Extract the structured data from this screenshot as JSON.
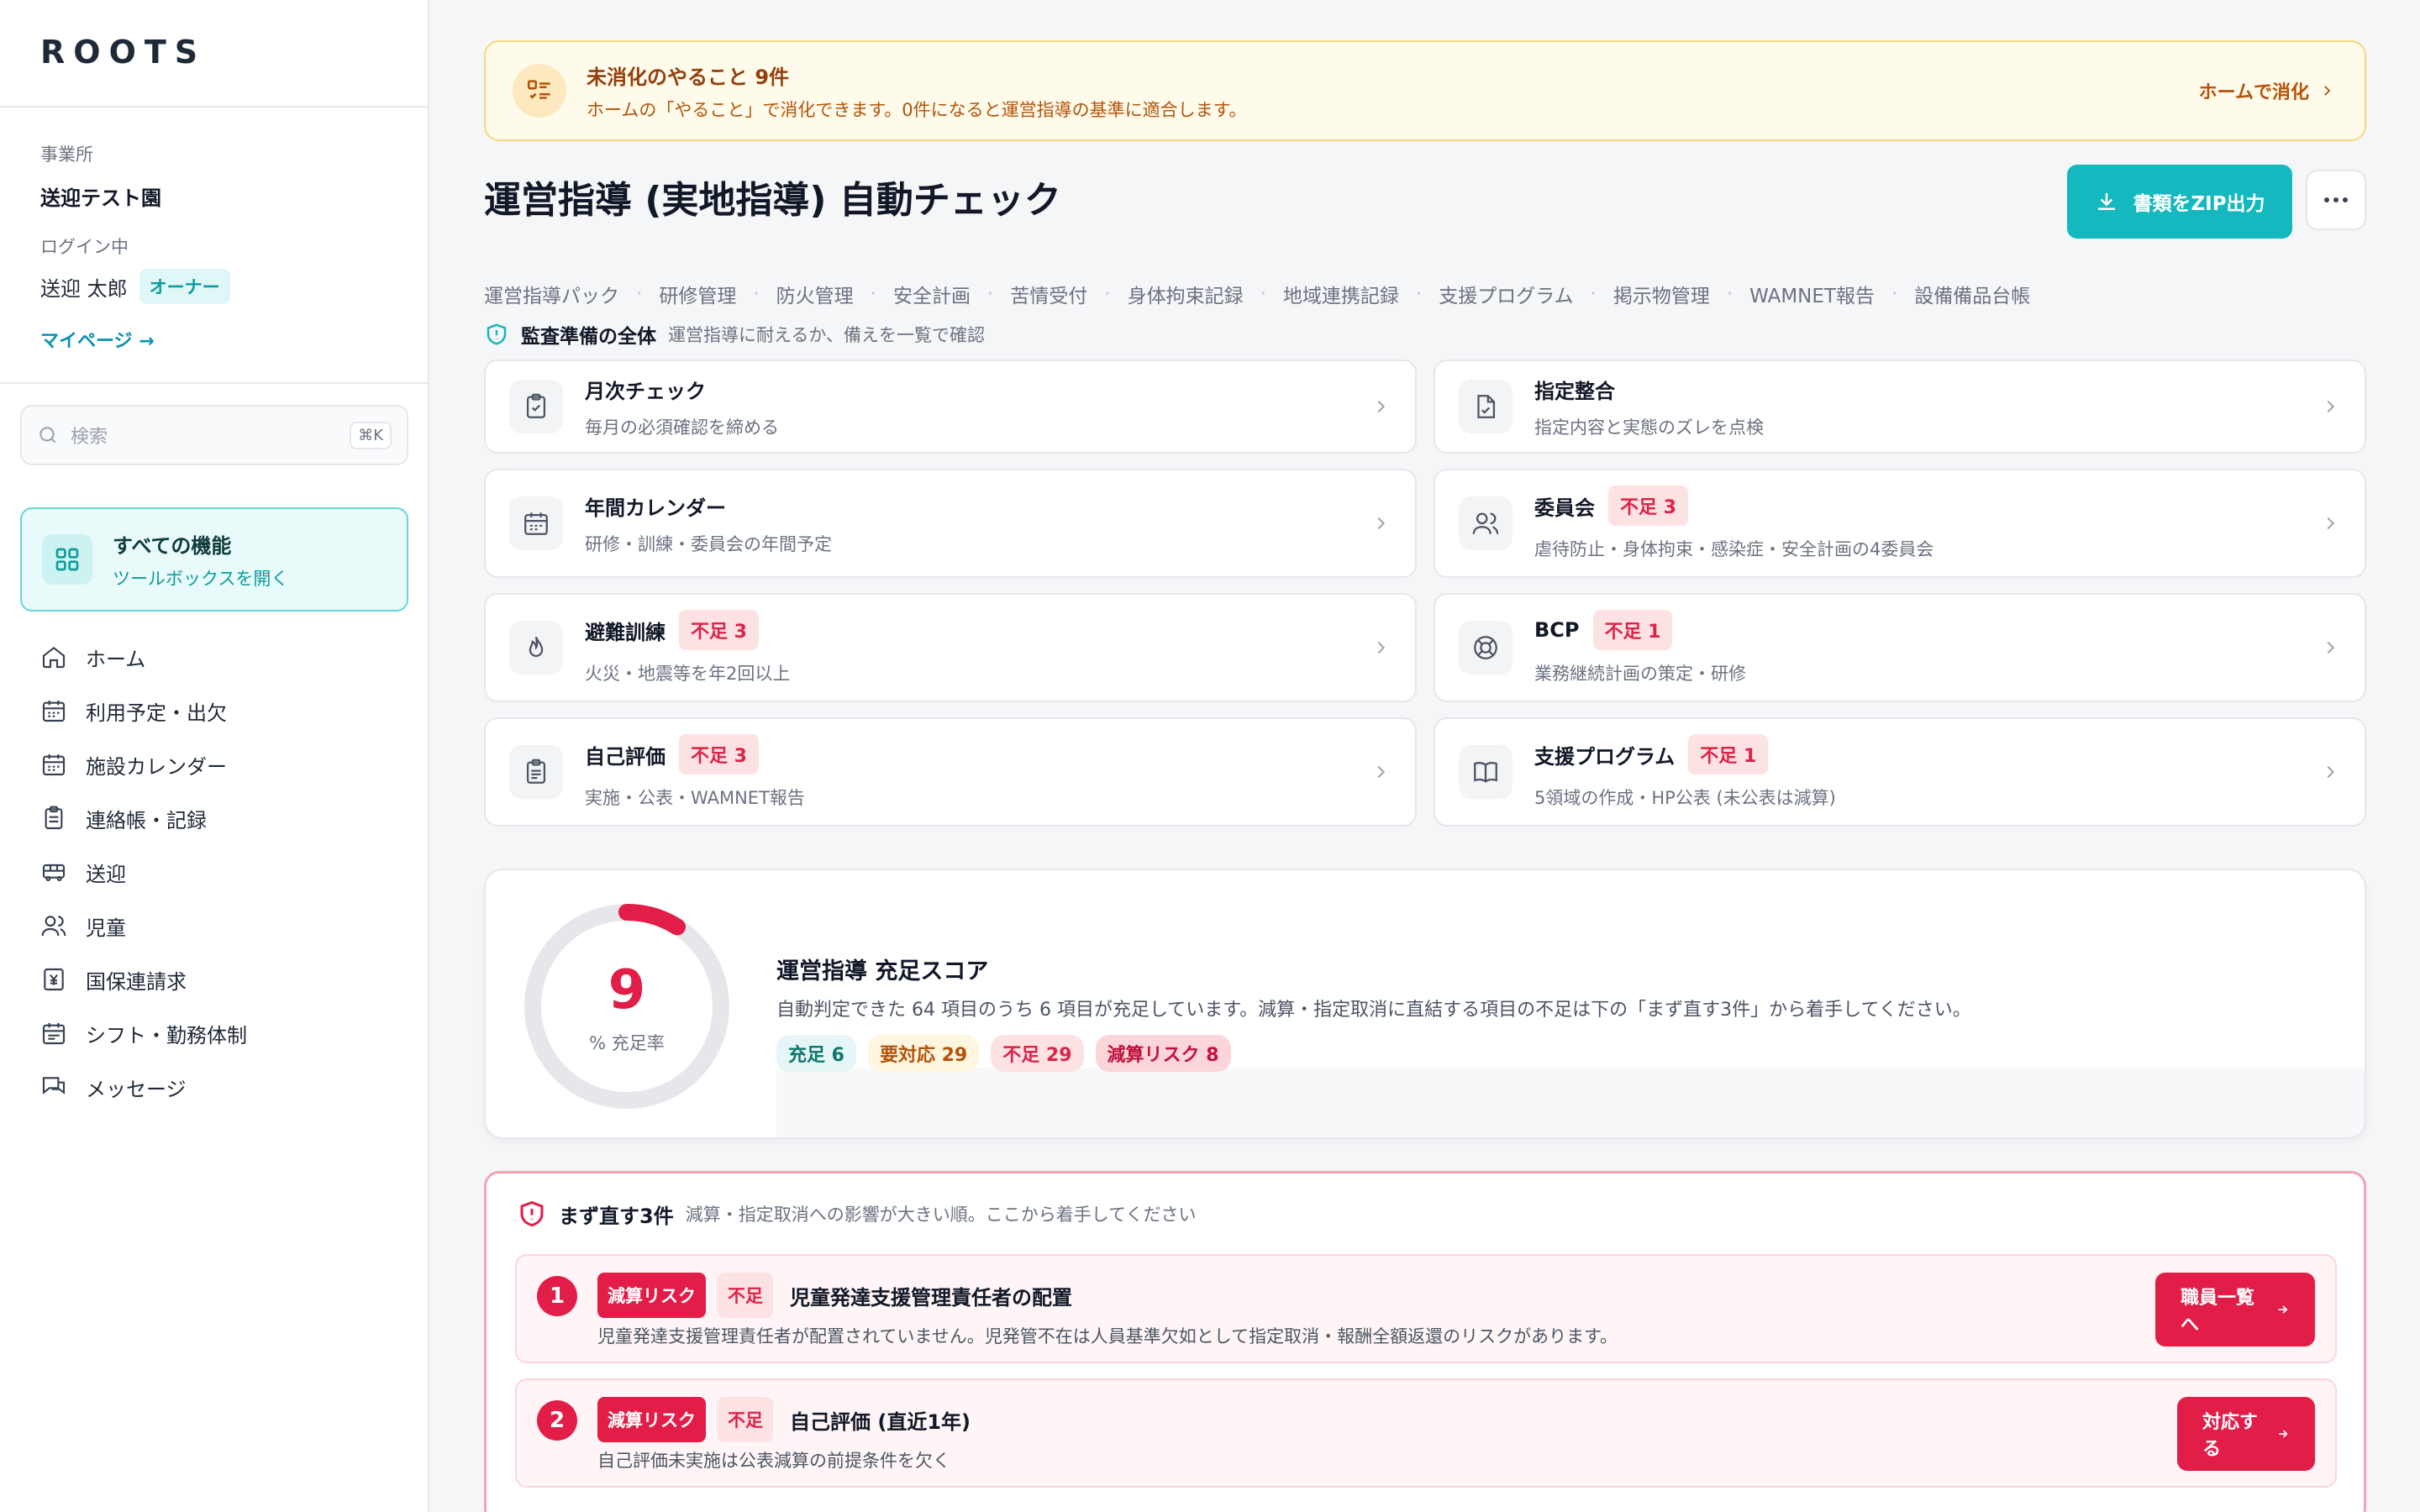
{
  "sidebar": {
    "logo": "ROOTS",
    "office_label": "事業所",
    "office_name": "送迎テスト園",
    "login_label": "ログイン中",
    "user_name": "送迎 太郎",
    "user_role": "オーナー",
    "mypage": "マイページ →",
    "search_placeholder": "検索",
    "search_shortcut": "⌘K",
    "all_features": {
      "title": "すべての機能",
      "subtitle": "ツールボックスを開く"
    },
    "nav": [
      {
        "label": "ホーム",
        "icon": "home-icon"
      },
      {
        "label": "利用予定・出欠",
        "icon": "calendar-icon"
      },
      {
        "label": "施設カレンダー",
        "icon": "calendar-icon"
      },
      {
        "label": "連絡帳・記録",
        "icon": "clipboard-icon"
      },
      {
        "label": "送迎",
        "icon": "bus-icon"
      },
      {
        "label": "児童",
        "icon": "users-icon"
      },
      {
        "label": "国保連請求",
        "icon": "yen-document-icon"
      },
      {
        "label": "シフト・勤務体制",
        "icon": "calendar-icon"
      },
      {
        "label": "メッセージ",
        "icon": "chat-icon"
      }
    ]
  },
  "todo_banner": {
    "title": "未消化のやること 9件",
    "subtitle": "ホームの「やること」で消化できます。0件になると運営指導の基準に適合します。",
    "action": "ホームで消化"
  },
  "page": {
    "title": "運営指導 (実地指導) 自動チェック",
    "zip_button": "書類をZIP出力"
  },
  "subnav": [
    "運営指導パック",
    "研修管理",
    "防火管理",
    "安全計画",
    "苦情受付",
    "身体拘束記録",
    "地域連携記録",
    "支援プログラム",
    "掲示物管理",
    "WAMNET報告",
    "設備備品台帳"
  ],
  "audit_section": {
    "title": "監査準備の全体",
    "subtitle": "運営指導に耐えるか、備えを一覧で確認"
  },
  "cards": [
    {
      "title": "月次チェック",
      "subtitle": "毎月の必須確認を締める",
      "badge": "",
      "icon": "clipboard-check-icon"
    },
    {
      "title": "指定整合",
      "subtitle": "指定内容と実態のズレを点検",
      "badge": "",
      "icon": "file-check-icon"
    },
    {
      "title": "年間カレンダー",
      "subtitle": "研修・訓練・委員会の年間予定",
      "badge": "",
      "icon": "calendar-icon"
    },
    {
      "title": "委員会",
      "subtitle": "虐待防止・身体拘束・感染症・安全計画の4委員会",
      "badge": "不足 3",
      "icon": "users-icon"
    },
    {
      "title": "避難訓練",
      "subtitle": "火災・地震等を年2回以上",
      "badge": "不足 3",
      "icon": "flame-icon"
    },
    {
      "title": "BCP",
      "subtitle": "業務継続計画の策定・研修",
      "badge": "不足 1",
      "icon": "lifebuoy-icon"
    },
    {
      "title": "自己評価",
      "subtitle": "実施・公表・WAMNET報告",
      "badge": "不足 3",
      "icon": "clipboard-list-icon"
    },
    {
      "title": "支援プログラム",
      "subtitle": "5領域の作成・HP公表 (未公表は減算)",
      "badge": "不足 1",
      "icon": "book-icon"
    }
  ],
  "score": {
    "value": "9",
    "percent": 9,
    "unit_label": "% 充足率",
    "title": "運営指導 充足スコア",
    "description": "自動判定できた 64 項目のうち 6 項目が充足しています。減算・指定取消に直結する項目の不足は下の「まず直す3件」から着手してください。",
    "chips": [
      {
        "label": "充足 6",
        "kind": "ok"
      },
      {
        "label": "要対応 29",
        "kind": "warn"
      },
      {
        "label": "不足 29",
        "kind": "ng"
      },
      {
        "label": "減算リスク 8",
        "kind": "risk"
      }
    ],
    "colors": {
      "accent": "#e11d48",
      "track": "#e5e7eb"
    }
  },
  "fix_first": {
    "title": "まず直す3件",
    "subtitle": "減算・指定取消への影響が大きい順。ここから着手してください",
    "items": [
      {
        "num": "1",
        "tag_risk": "減算リスク",
        "tag_ng": "不足",
        "title": "児童発達支援管理責任者の配置",
        "description": "児童発達支援管理責任者が配置されていません。児発管不在は人員基準欠如として指定取消・報酬全額返還のリスクがあります。",
        "action": "職員一覧へ"
      },
      {
        "num": "2",
        "tag_risk": "減算リスク",
        "tag_ng": "不足",
        "title": "自己評価 (直近1年)",
        "description": "自己評価未実施は公表減算の前提条件を欠く",
        "action": "対応する"
      }
    ]
  }
}
